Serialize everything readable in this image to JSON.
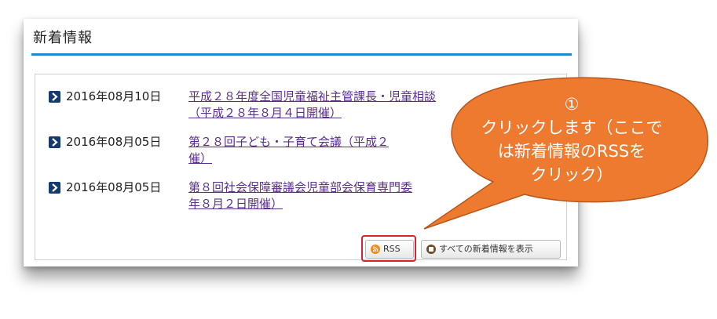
{
  "section": {
    "title": "新着情報"
  },
  "news": [
    {
      "date": "2016年08月10日",
      "link_lines": [
        "平成２８年度全国児童福祉主管課長・児童相談",
        "（平成２８年８月４日開催）"
      ]
    },
    {
      "date": "2016年08月05日",
      "link_lines": [
        "第２８回子ども・子育て会議（平成２",
        "催）"
      ]
    },
    {
      "date": "2016年08月05日",
      "link_lines": [
        "第８回社会保障審議会児童部会保育専門委",
        "年８月２日開催）"
      ]
    }
  ],
  "buttons": {
    "rss_label": "RSS",
    "all_label": "すべての新着情報を表示"
  },
  "callout": {
    "number": "①",
    "lines": [
      "クリックします（ここで",
      "は新着情報のRSSを",
      "クリック）"
    ]
  },
  "colors": {
    "accent_rule": "#1e88d4",
    "link": "#5a2d91",
    "bullet": "#143a6e",
    "callout_fill": "#ee7a2f",
    "highlight": "#d9232e",
    "rss_icon": "#f28c1e"
  },
  "icons": {
    "bullet": "chevron-right-icon",
    "rss": "rss-icon",
    "all": "list-icon"
  }
}
